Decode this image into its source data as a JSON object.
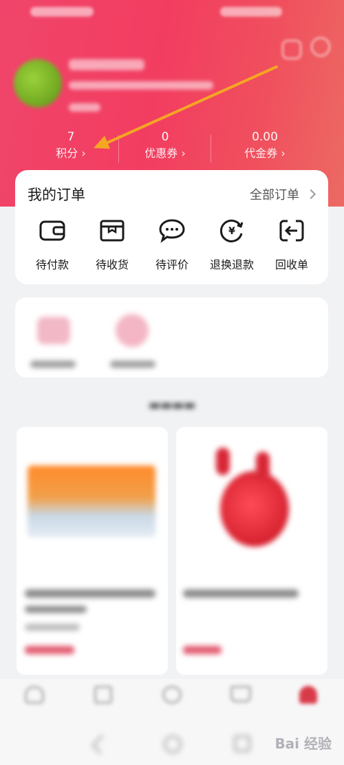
{
  "stats": [
    {
      "value": "7",
      "label": "积分 ›"
    },
    {
      "value": "0",
      "label": "优惠券 ›"
    },
    {
      "value": "0.00",
      "label": "代金券 ›"
    }
  ],
  "orders": {
    "title": "我的订单",
    "all_label": "全部订单",
    "items": [
      {
        "label": "待付款",
        "icon": "wallet-icon"
      },
      {
        "label": "待收货",
        "icon": "package-icon"
      },
      {
        "label": "待评价",
        "icon": "chat-bubble-icon"
      },
      {
        "label": "退换退款",
        "icon": "refund-icon"
      },
      {
        "label": "回收单",
        "icon": "recycle-icon"
      }
    ]
  },
  "watermark": "Bai 经验",
  "colors": {
    "header_start": "#f0456a",
    "header_end": "#ec6a63",
    "arrow": "#f5a623"
  }
}
